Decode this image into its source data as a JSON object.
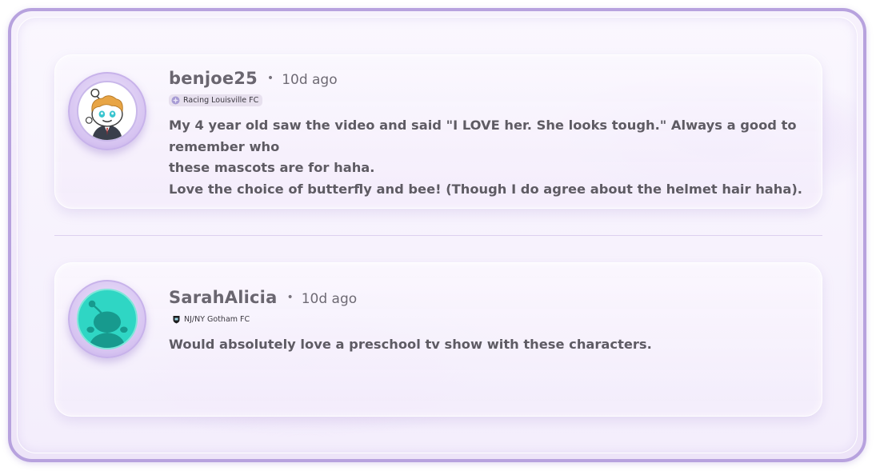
{
  "comments": [
    {
      "username": "benjoe25",
      "separator": "•",
      "time": "10d ago",
      "flair": "Racing Louisville FC",
      "flair_icon": "racing-louisville-crest-icon",
      "avatar": "snoo-avatar-blond-suit",
      "lines": [
        "My 4 year old saw the video and said \"I LOVE her. She looks tough.\" Always a good to",
        "remember who",
        "these mascots are for haha.",
        "Love the choice of butterfly and bee! (Though I do agree about the helmet hair haha)."
      ]
    },
    {
      "username": "SarahAlicia",
      "separator": "•",
      "time": "10d ago",
      "flair": "NJ/NY Gotham FC",
      "flair_icon": "gotham-fc-crest-icon",
      "avatar": "snoo-avatar-default-teal",
      "lines": [
        "Would absolutely love a preschool tv show with these characters."
      ]
    }
  ],
  "colors": {
    "frame_border": "#b7a2de",
    "background": "#f4eefc",
    "username": "#6a6670",
    "body_text": "#5e5b63",
    "avatar_teal": "#2fd6c4"
  }
}
